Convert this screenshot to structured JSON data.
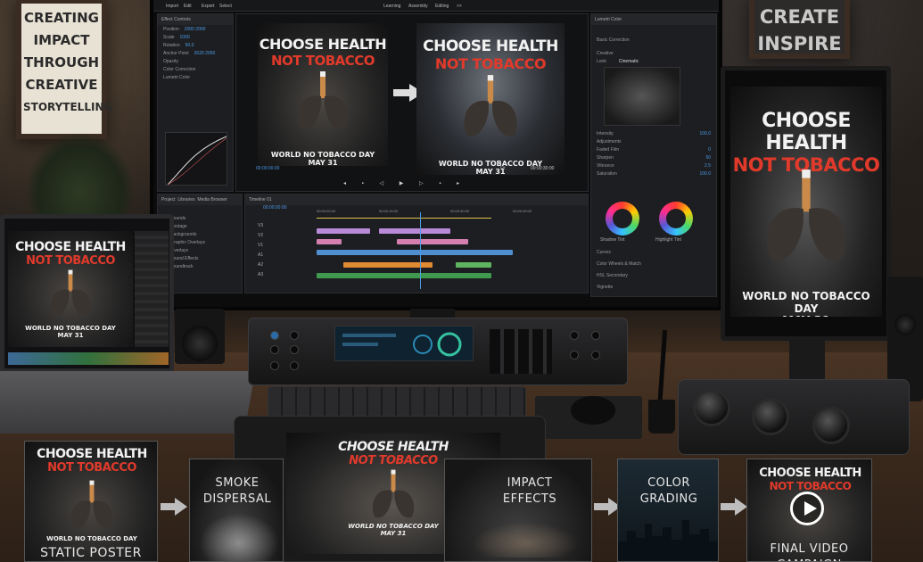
{
  "wall": {
    "left_sign": [
      "CREATING",
      "IMPACT",
      "THROUGH",
      "CREATIVE",
      "STORYTELLING"
    ],
    "right_sign": [
      "CREATE",
      "INSPIRE"
    ]
  },
  "poster": {
    "title_line1": "CHOOSE HEALTH",
    "title_line2": "NOT TOBACCO",
    "subtitle": "WORLD NO TOBACCO DAY",
    "date": "MAY 31"
  },
  "editor": {
    "topbar": {
      "menu": [
        "Import",
        "Edit",
        "Export",
        "Select"
      ],
      "workspaces": [
        "Learning",
        "Assembly",
        "Editing",
        ">>"
      ]
    },
    "effect_controls": {
      "tab": "Effect Controls",
      "rows": [
        {
          "label": "Position",
          "value": "2000  2000"
        },
        {
          "label": "Scale",
          "value": "1000"
        },
        {
          "label": "Rotation",
          "value": "50.0"
        },
        {
          "label": "Anchor Point",
          "value": "2020  2050"
        },
        {
          "label": "Opacity",
          "value": ""
        },
        {
          "label": "Color Correction",
          "value": ""
        },
        {
          "label": "Color Correction",
          "value": ""
        },
        {
          "label": "Lumetri Color",
          "value": ""
        }
      ]
    },
    "program": {
      "timecode_left": "00:00:00:00",
      "timecode_right": "00:00:30:00",
      "fit_label": "Fit"
    },
    "lumetri": {
      "title": "Lumetri Color",
      "sections": [
        "Basic Correction",
        "Creative"
      ],
      "look_label": "Look",
      "look_value": "Cinematic",
      "intensity_label": "Intensity",
      "intensity_value": "100.0",
      "adjustments_label": "Adjustments",
      "sliders": [
        {
          "label": "Faded Film",
          "value": "0"
        },
        {
          "label": "Sharpen",
          "value": "50"
        },
        {
          "label": "Vibrance",
          "value": "2.5"
        },
        {
          "label": "Saturation",
          "value": "100.0"
        }
      ],
      "wheels": [
        "Shadow Tint",
        "Highlight Tint"
      ],
      "bottom_sections": [
        "Curves",
        "Color Wheels & Match",
        "HSL Secondary",
        "Vignette"
      ]
    },
    "project": {
      "tabs": [
        "Project",
        "Libraries",
        "Media Browser"
      ],
      "folders": [
        "Sounds",
        "Footage",
        "Backgrounds",
        "Graphic Overlays",
        "Overlays",
        "Sound Effects",
        "Soundtrack"
      ]
    },
    "timeline": {
      "tab": "Timeline 01",
      "timecode": "00:00:00:00",
      "ruler": [
        "00:00:00:00",
        "00:00:15:00",
        "00:00:30:00",
        "00:00:45:00"
      ],
      "tracks": [
        "V3",
        "V2",
        "V1",
        "A1",
        "A2",
        "A3"
      ]
    }
  },
  "workflow": {
    "steps": [
      "STATIC POSTER",
      "SMOKE DISPERSAL",
      "IMPACT EFFECTS",
      "COLOR GRADING",
      "FINAL VIDEO CAMPAIGN"
    ]
  },
  "colors": {
    "accent_red": "#e13a2b",
    "accent_blue": "#4d9be6",
    "background": "#1c1713"
  }
}
